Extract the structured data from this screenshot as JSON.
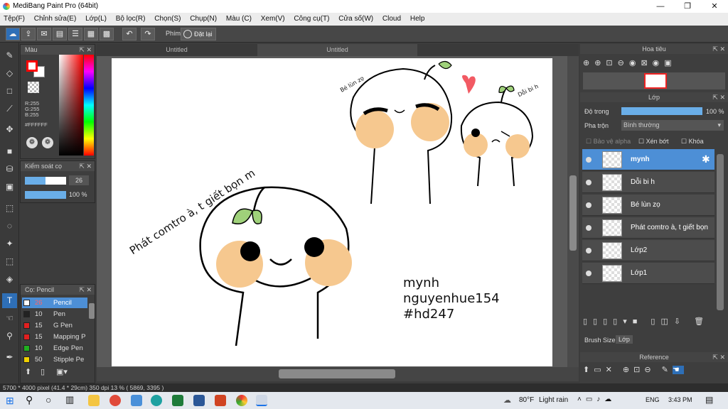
{
  "window": {
    "title": "MediBang Paint Pro (64bit)",
    "minimize": "—",
    "maximize": "❐",
    "close": "✕"
  },
  "menu": [
    "Tệp(F)",
    "Chỉnh sửa(E)",
    "Lớp(L)",
    "Bộ lọc(R)",
    "Chọn(S)",
    "Chụp(N)",
    "Màu (C)",
    "Xem(V)",
    "Công cụ(T)",
    "Cửa số(W)",
    "Cloud",
    "Help"
  ],
  "toolbar": {
    "shortcut_label": "Phím",
    "reset_label": "Đặt lại"
  },
  "color_panel": {
    "title": "Màu",
    "r": "R:255",
    "g": "G:255",
    "b": "B:255",
    "hex": "#FFFFFF",
    "primary": "#ff0000",
    "secondary": "#ffffff"
  },
  "brush_control": {
    "title": "Kiểm soát cọ",
    "size": "26",
    "opacity": "100 %"
  },
  "brush_panel": {
    "title": "Cọ: Pencil",
    "items": [
      {
        "size": "26",
        "name": "Pencil",
        "color": "#ffffff"
      },
      {
        "size": "10",
        "name": "Pen",
        "color": "#222222"
      },
      {
        "size": "15",
        "name": "G Pen",
        "color": "#e02020"
      },
      {
        "size": "15",
        "name": "Mapping P",
        "color": "#e02020"
      },
      {
        "size": "10",
        "name": "Edge Pen",
        "color": "#20b020"
      },
      {
        "size": "50",
        "name": "Stipple Pe",
        "color": "#f0d000"
      }
    ]
  },
  "tabs": [
    "Untitled",
    "Untitled"
  ],
  "canvas_text": {
    "phat": "Phát comtro à, t giết bọn m",
    "be": "Bé lùn zọ",
    "doi": "Dỗi bi h",
    "sig1": "mynh",
    "sig2": "nguyenhue154",
    "sig3": "#hd247"
  },
  "navigator": {
    "title": "Hoa tiêu"
  },
  "layer_panel": {
    "title": "Lớp",
    "opacity_label": "Độ trong",
    "opacity_value": "100 %",
    "blend_label": "Pha trộn",
    "blend_value": "Bình thường",
    "alpha_label": "Bảo vệ alpha",
    "clip_label": "Xén bớt",
    "lock_label": "Khóa",
    "layers": [
      "mynh",
      "Dỗi bi h",
      "Bé lùn zọ",
      "Phát comtro à, t giết bọn",
      "Lớp2",
      "Lớp1"
    ],
    "tab_brush": "Brush Size",
    "tab_layer": "Lớp"
  },
  "reference": {
    "title": "Reference"
  },
  "status": "5700 * 4000 pixel  (41.4 * 29cm)   350 dpi   13 %   ( 5869, 3395 )",
  "taskbar": {
    "weather_temp": "80°F",
    "weather_desc": "Light rain",
    "lang": "ENG",
    "time": "3:43 PM"
  }
}
